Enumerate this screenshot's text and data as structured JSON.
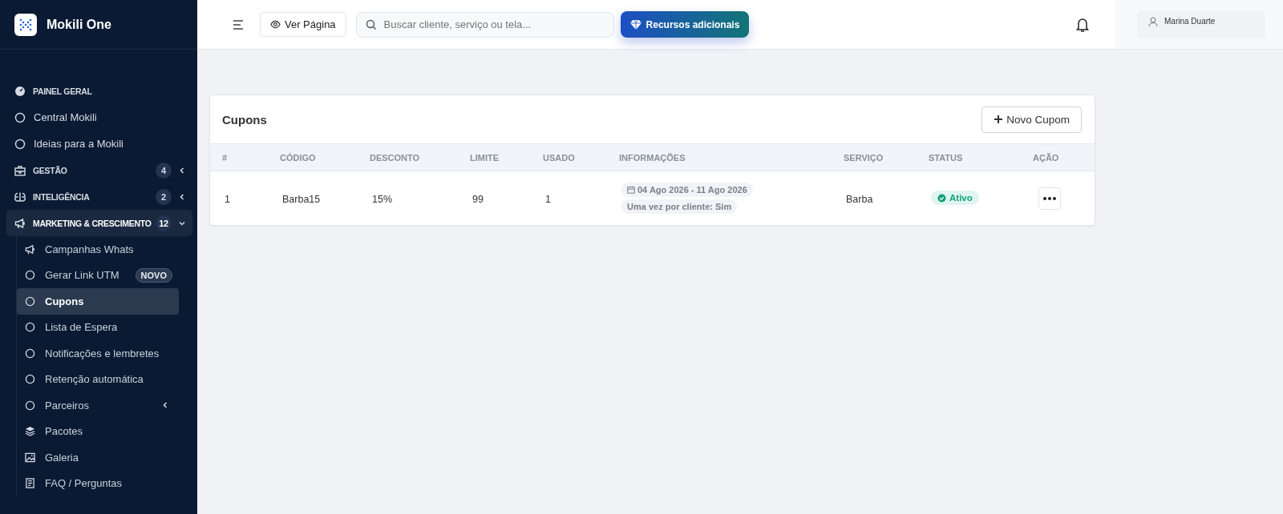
{
  "brand": {
    "name": "Mokili One"
  },
  "sidebar": {
    "items": [
      {
        "label": "PAINEL GERAL",
        "kind": "section"
      },
      {
        "label": "Central Mokili",
        "kind": "link"
      },
      {
        "label": "Ideias para a Mokili",
        "kind": "link"
      },
      {
        "label": "GESTÃO",
        "kind": "section",
        "badge": "4",
        "expanded": false
      },
      {
        "label": "INTELIGÊNCIA",
        "kind": "section",
        "badge": "2",
        "expanded": false
      },
      {
        "label": "MARKETING & CRESCIMENTO",
        "kind": "section",
        "badge": "12",
        "expanded": true,
        "children": [
          {
            "label": "Campanhas Whats",
            "selected": false
          },
          {
            "label": "Gerar Link UTM",
            "selected": false,
            "tag": "NOVO"
          },
          {
            "label": "Cupons",
            "selected": true
          },
          {
            "label": "Lista de Espera",
            "selected": false
          },
          {
            "label": "Notificações e lembretes",
            "selected": false
          },
          {
            "label": "Retenção automática",
            "selected": false
          },
          {
            "label": "Parceiros",
            "selected": false,
            "expanded": false
          },
          {
            "label": "Pacotes",
            "selected": false
          },
          {
            "label": "Galeria",
            "selected": false
          },
          {
            "label": "FAQ / Perguntas",
            "selected": false
          }
        ]
      }
    ]
  },
  "header": {
    "view_button": "Ver Página",
    "search": {
      "placeholder": "Buscar cliente, serviço ou tela..."
    },
    "resources_button": "Recursos adicionais",
    "user": "Marina Duarte"
  },
  "card": {
    "title": "Cupons",
    "new_button": "Novo Cupom",
    "table": {
      "columns": [
        "#",
        "CÓDIGO",
        "DESCONTO",
        "LIMITE",
        "USADO",
        "INFORMAÇÕES",
        "SERVIÇO",
        "STATUS",
        "AÇÃO"
      ],
      "rows": [
        {
          "number": "1",
          "code": "Barba15",
          "discount": "15%",
          "limit": "99",
          "used": "1",
          "period": "04 Ago 2026 - 11 Ago 2026",
          "rule": "Uma vez por cliente: Sim",
          "service": "Barba",
          "status": {
            "label": "Ativo",
            "kind": "active"
          }
        }
      ]
    }
  }
}
